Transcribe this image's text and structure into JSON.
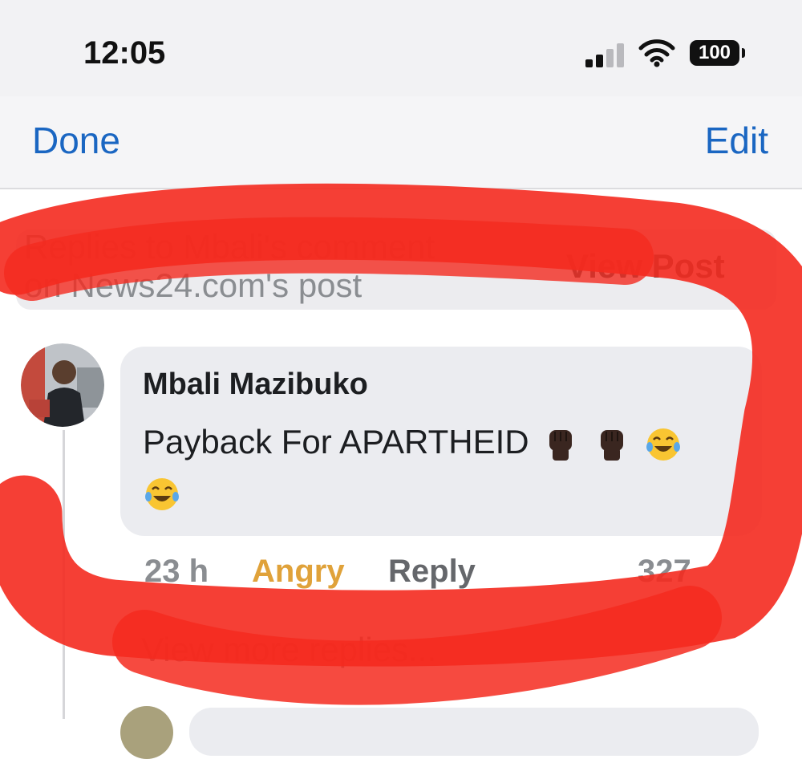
{
  "status_bar": {
    "time": "12:05",
    "battery": "100",
    "icons": [
      "signal-icon",
      "wifi-icon",
      "battery-icon"
    ]
  },
  "nav": {
    "done_label": "Done",
    "edit_label": "Edit"
  },
  "header": {
    "title_line1": "Replies to Mbali's comment",
    "title_line2": "on News24.com's post",
    "view_post_label": "View Post"
  },
  "comment": {
    "author": "Mbali Mazibuko",
    "text": "Payback For APARTHEID",
    "emojis": [
      "raised-fist-dark-emoji",
      "raised-fist-dark-emoji",
      "tears-of-joy-emoji",
      "tears-of-joy-emoji"
    ],
    "time_ago": "23 h",
    "reaction": "Angry",
    "reply_label": "Reply",
    "reaction_count": "327"
  },
  "replies": {
    "view_more_label": "View more replies..."
  },
  "colors": {
    "link_blue": "#1a66c2",
    "bubble_gray": "#ebecf0",
    "angry_orange": "#e0a23a",
    "marker_red": "#f42a1f"
  }
}
